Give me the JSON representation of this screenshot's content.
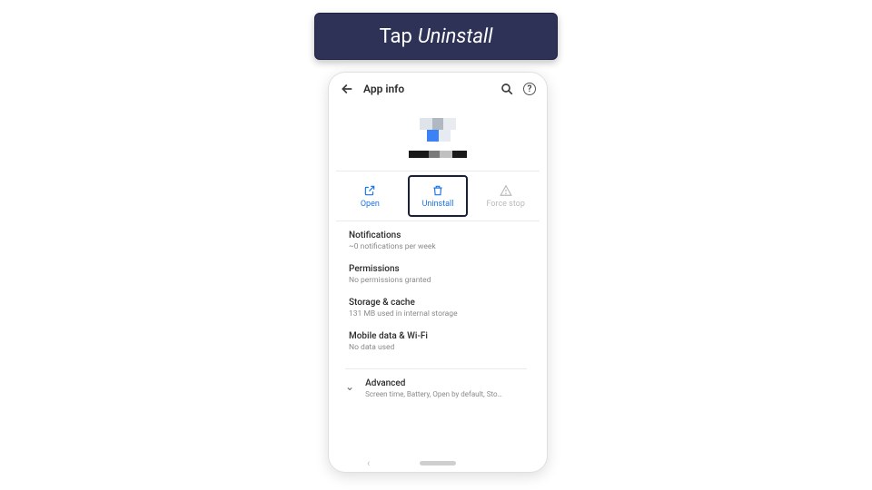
{
  "callout": {
    "prefix": "Tap",
    "emph": "Uninstall"
  },
  "topbar": {
    "title": "App info"
  },
  "icons": {
    "back": "back-arrow-icon",
    "search": "search-icon",
    "help": "help-icon",
    "open": "external-link-icon",
    "uninstall": "trash-icon",
    "forcestop": "warning-triangle-icon",
    "chevron": "chevron-down-icon"
  },
  "actions": {
    "open": "Open",
    "uninstall": "Uninstall",
    "forcestop": "Force stop"
  },
  "settings": [
    {
      "label": "Notifications",
      "sub": "~0 notifications per week"
    },
    {
      "label": "Permissions",
      "sub": "No permissions granted"
    },
    {
      "label": "Storage & cache",
      "sub": "131 MB used in internal storage"
    },
    {
      "label": "Mobile data & Wi-Fi",
      "sub": "No data used"
    }
  ],
  "advanced": {
    "label": "Advanced",
    "sub": "Screen time, Battery, Open by default, Sto…"
  }
}
